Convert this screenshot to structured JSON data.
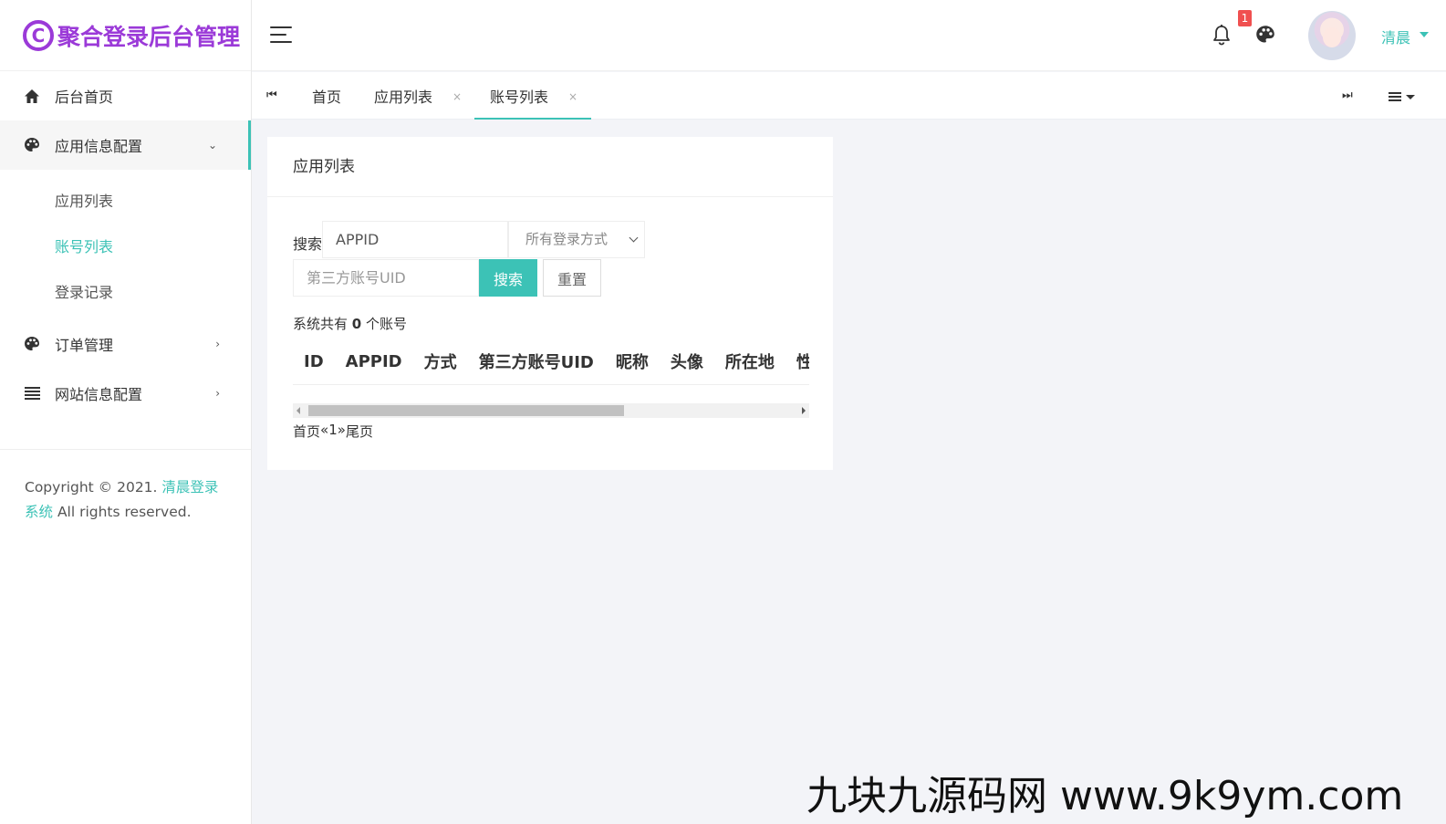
{
  "app": {
    "logo_mark": "C",
    "title": "聚合登录后台管理"
  },
  "sidebar": {
    "items": [
      {
        "label": "后台首页",
        "icon": "home-icon"
      },
      {
        "label": "应用信息配置",
        "icon": "palette-icon",
        "chevron": "⌄"
      },
      {
        "label": "订单管理",
        "icon": "palette-icon",
        "chevron": "›"
      },
      {
        "label": "网站信息配置",
        "icon": "list-icon",
        "chevron": "›"
      }
    ],
    "subitems": [
      {
        "label": "应用列表"
      },
      {
        "label": "账号列表"
      },
      {
        "label": "登录记录"
      }
    ],
    "footer": {
      "prefix": "Copyright © 2021. ",
      "brand": "清晨登录系统",
      "suffix": " All rights reserved."
    }
  },
  "header": {
    "notification_count": "1",
    "user_name": "清晨"
  },
  "tabs": {
    "prev_icon": "⏮",
    "next_icon": "⏭",
    "items": [
      {
        "label": "首页"
      },
      {
        "label": "应用列表",
        "close": "×"
      },
      {
        "label": "账号列表",
        "close": "×"
      }
    ]
  },
  "card": {
    "title": "应用列表",
    "search_label": "搜索",
    "appid_placeholder": "APPID",
    "login_select": "所有登录方式",
    "uid_placeholder": "第三方账号UID",
    "search_button": "搜索",
    "reset_button": "重置",
    "summary_prefix": "系统共有 ",
    "summary_count": "0",
    "summary_suffix": " 个账号",
    "columns": [
      "ID",
      "APPID",
      "方式",
      "第三方账号UID",
      "昵称",
      "头像",
      "所在地",
      "性别"
    ],
    "pager": [
      "首页",
      "«",
      "1",
      "»",
      "尾页"
    ]
  },
  "watermark": "九块九源码网 www.9k9ym.com",
  "colors": {
    "accent": "#3cc2b6",
    "brand": "#9b3ad8",
    "badge": "#f05050"
  }
}
